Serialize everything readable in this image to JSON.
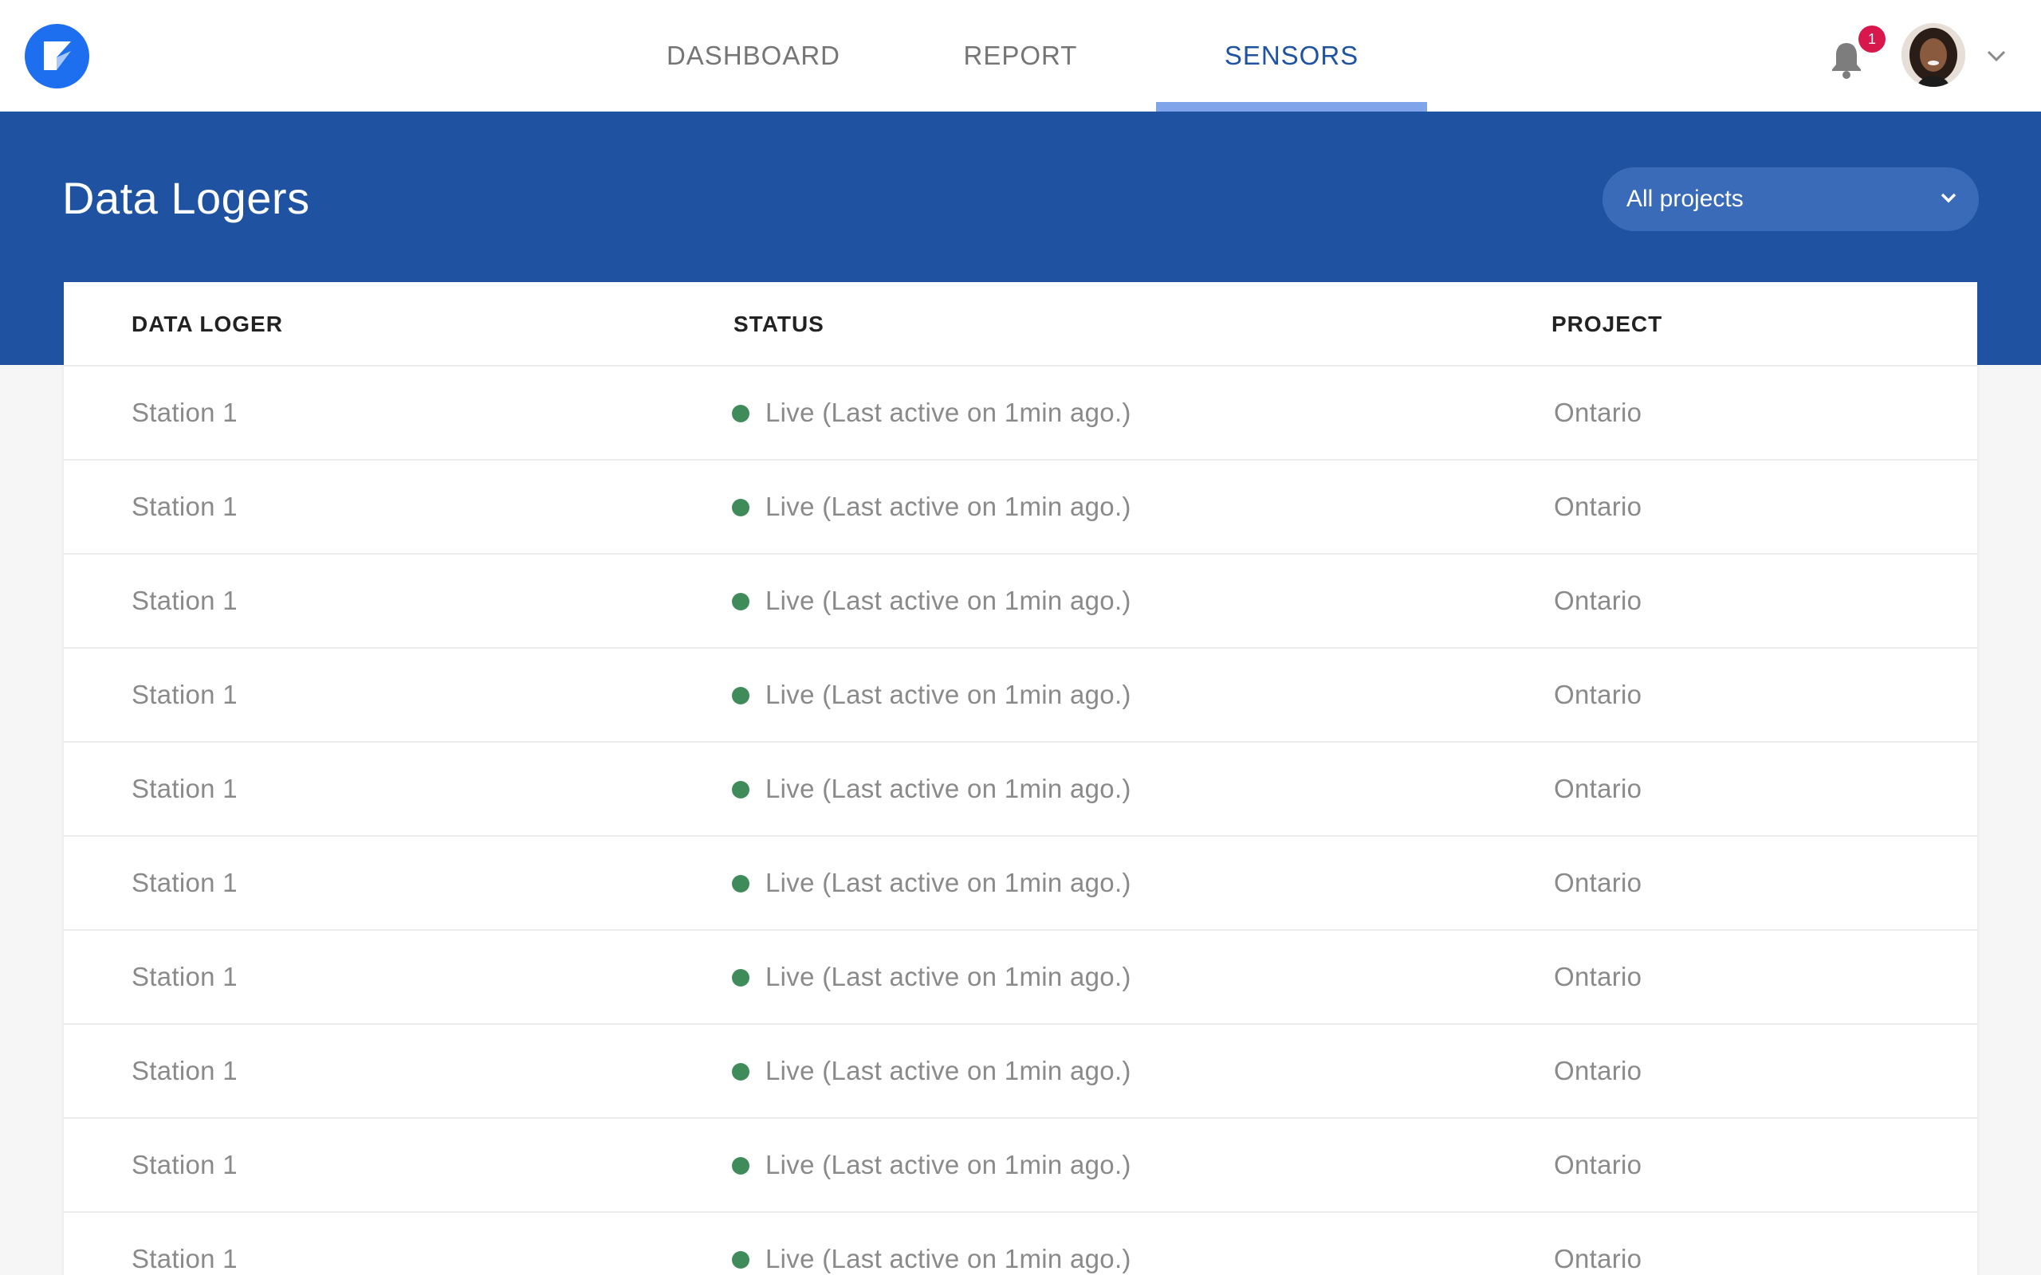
{
  "nav": {
    "tabs": [
      {
        "label": "DASHBOARD",
        "active": false
      },
      {
        "label": "REPORT",
        "active": false
      },
      {
        "label": "SENSORS",
        "active": true
      }
    ],
    "notification_count": "1",
    "icons": {
      "logo": "brand-logo-icon",
      "bell": "bell-icon",
      "user_menu": "chevron-down-icon"
    }
  },
  "header": {
    "title": "Data Logers",
    "project_filter": "All projects"
  },
  "table": {
    "columns": [
      "DATA LOGER",
      "STATUS",
      "PROJECT"
    ],
    "rows": [
      {
        "name": "Station 1",
        "status": "Live (Last active on 1min ago.)",
        "project": "Ontario"
      },
      {
        "name": "Station 1",
        "status": "Live (Last active on 1min ago.)",
        "project": "Ontario"
      },
      {
        "name": "Station 1",
        "status": "Live (Last active on 1min ago.)",
        "project": "Ontario"
      },
      {
        "name": "Station 1",
        "status": "Live (Last active on 1min ago.)",
        "project": "Ontario"
      },
      {
        "name": "Station 1",
        "status": "Live (Last active on 1min ago.)",
        "project": "Ontario"
      },
      {
        "name": "Station 1",
        "status": "Live (Last active on 1min ago.)",
        "project": "Ontario"
      },
      {
        "name": "Station 1",
        "status": "Live (Last active on 1min ago.)",
        "project": "Ontario"
      },
      {
        "name": "Station 1",
        "status": "Live (Last active on 1min ago.)",
        "project": "Ontario"
      },
      {
        "name": "Station 1",
        "status": "Live (Last active on 1min ago.)",
        "project": "Ontario"
      },
      {
        "name": "Station 1",
        "status": "Live (Last active on 1min ago.)",
        "project": "Ontario"
      }
    ]
  },
  "colors": {
    "brand": "#1f53a1",
    "accent": "#1e6ff0",
    "live": "#3f8c5a",
    "badge": "#d8184c",
    "tab_indicator": "#7fa4ea"
  }
}
